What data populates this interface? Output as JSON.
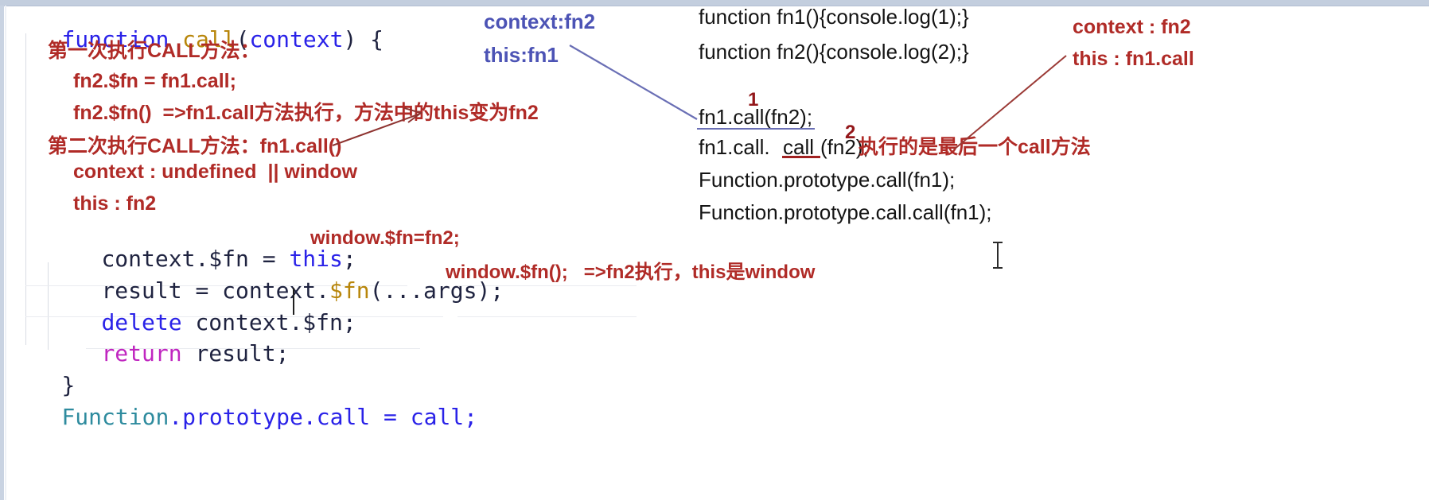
{
  "editor": {
    "language": "javascript",
    "caret_line": "delete context.$fn;"
  },
  "code_lines": [
    {
      "id": "l1",
      "segments": [
        {
          "text": "function",
          "style": "kw"
        },
        {
          "text": " ",
          "style": "plain"
        },
        {
          "text": "call",
          "style": "fn"
        },
        {
          "text": "(",
          "style": "plain"
        },
        {
          "text": "context",
          "style": "var"
        },
        {
          "text": ") {",
          "style": "plain"
        }
      ]
    },
    {
      "id": "l2",
      "segments": [
        {
          "text": "context.$fn = ",
          "style": "plain"
        },
        {
          "text": "this",
          "style": "kw"
        },
        {
          "text": ";",
          "style": "plain"
        }
      ]
    },
    {
      "id": "l3",
      "segments": [
        {
          "text": "result = context.",
          "style": "plain"
        },
        {
          "text": "$fn",
          "style": "fn"
        },
        {
          "text": "(...args);",
          "style": "plain"
        }
      ]
    },
    {
      "id": "l4",
      "segments": [
        {
          "text": "delete",
          "style": "kw"
        },
        {
          "text": " context.$fn;",
          "style": "plain"
        }
      ]
    },
    {
      "id": "l5",
      "segments": [
        {
          "text": "return",
          "style": "kw2"
        },
        {
          "text": " result;",
          "style": "plain"
        }
      ]
    },
    {
      "id": "l6",
      "segments": [
        {
          "text": "}",
          "style": "plain"
        }
      ]
    },
    {
      "id": "l7",
      "segments": [
        {
          "text": "Function",
          "style": "type"
        },
        {
          "text": ".prototype.call = call;",
          "style": "plain"
        }
      ]
    }
  ],
  "annotations": {
    "left_red": [
      {
        "id": "a1",
        "text": "第一次执行CALL方法："
      },
      {
        "id": "a2",
        "text": "fn2.$fn = fn1.call;"
      },
      {
        "id": "a3",
        "text": "fn2.$fn()  =>fn1.call方法执行，方法中的this变为fn2"
      },
      {
        "id": "a4",
        "text": "第二次执行CALL方法：fn1.call()"
      },
      {
        "id": "a5",
        "text": "context : undefined  || window"
      },
      {
        "id": "a6",
        "text": "this : fn2"
      },
      {
        "id": "a7",
        "text": "window.$fn=fn2;"
      },
      {
        "id": "a8",
        "text": "window.$fn();   =>fn2执行，this是window"
      }
    ],
    "blue_labels": [
      {
        "id": "b1",
        "text": "context:fn2"
      },
      {
        "id": "b2",
        "text": "this:fn1"
      }
    ],
    "right_code": [
      {
        "id": "r1",
        "text": "function fn1(){console.log(1);}"
      },
      {
        "id": "r2",
        "text": "function fn2(){console.log(2);}"
      },
      {
        "id": "r3",
        "text": "fn1.call(fn2);"
      },
      {
        "id": "r4a",
        "text": "fn1.call."
      },
      {
        "id": "r4b",
        "text": "call"
      },
      {
        "id": "r4c",
        "text": "(fn2);"
      },
      {
        "id": "r5",
        "text": "Function.prototype.call(fn1);"
      },
      {
        "id": "r6",
        "text": "Function.prototype.call.call(fn1);"
      }
    ],
    "markers": [
      {
        "id": "m1",
        "text": "1"
      },
      {
        "id": "m2",
        "text": "2"
      }
    ],
    "right_note": {
      "text": "执行的是最后一个call方法"
    },
    "top_right_red": [
      {
        "id": "t1",
        "text": "context : fn2"
      },
      {
        "id": "t2",
        "text": "this : fn1.call"
      }
    ]
  },
  "colors": {
    "keyword_blue": "#2a22e8",
    "keyword_magenta": "#c026c0",
    "identifier_gold": "#b8860b",
    "type_teal": "#2e8b9e",
    "annotation_red": "#b02b27",
    "annotation_blue": "#4c53b5",
    "marker_darkred": "#93171a",
    "code_dark": "#141414",
    "background": "#ffffff"
  }
}
